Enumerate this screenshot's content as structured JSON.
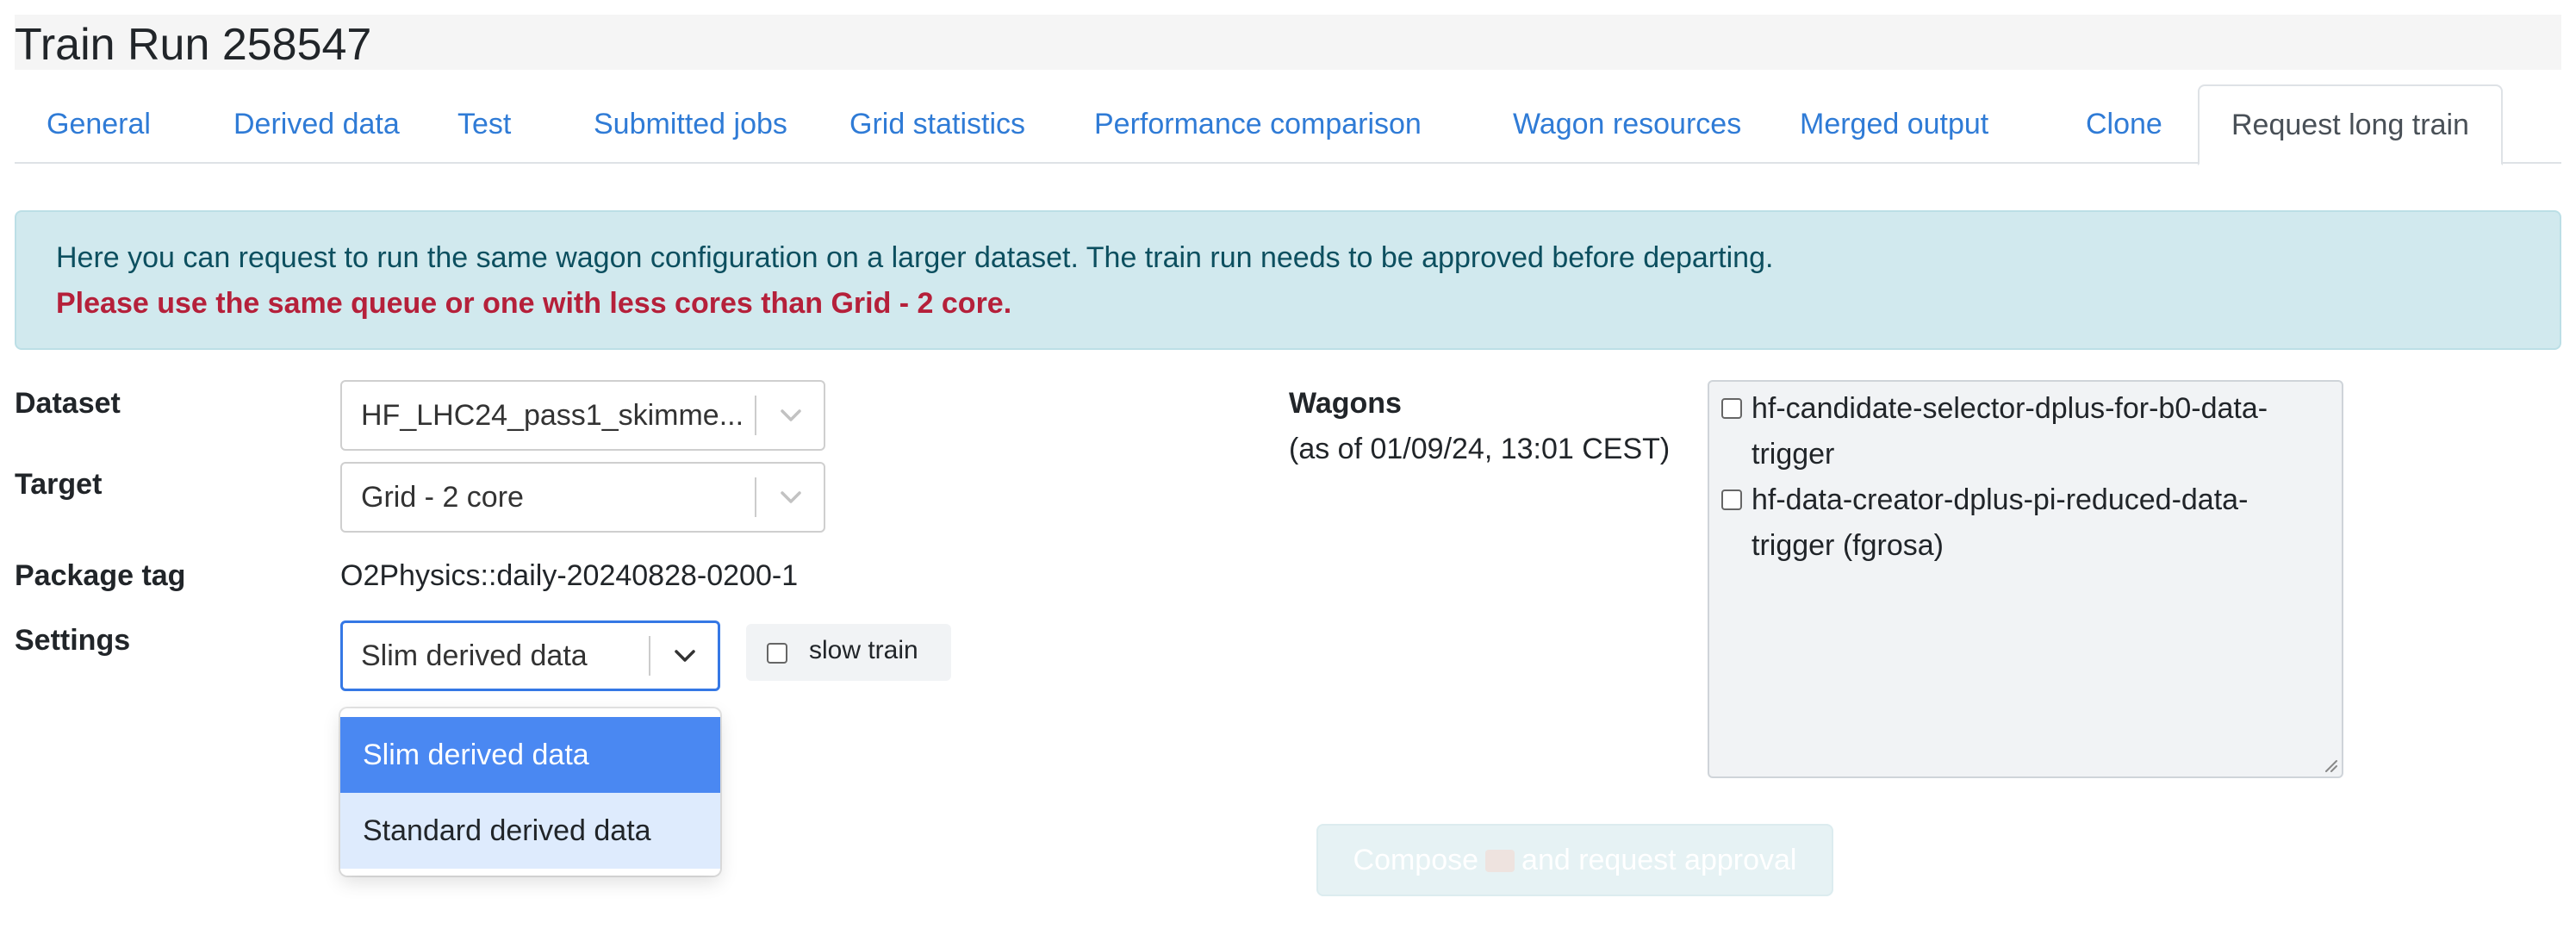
{
  "page": {
    "title": "Train Run 258547"
  },
  "tabs": [
    {
      "label": "General"
    },
    {
      "label": "Derived data"
    },
    {
      "label": "Test"
    },
    {
      "label": "Submitted jobs"
    },
    {
      "label": "Grid statistics"
    },
    {
      "label": "Performance comparison"
    },
    {
      "label": "Wagon resources"
    },
    {
      "label": "Merged output"
    },
    {
      "label": "Clone"
    },
    {
      "label": "Request long train",
      "active": true
    }
  ],
  "alert": {
    "info": "Here you can request to run the same wagon configuration on a larger dataset. The train run needs to be approved before departing.",
    "warning": "Please use the same queue or one with less cores than Grid - 2 core."
  },
  "form": {
    "dataset_label": "Dataset",
    "dataset_value": "HF_LHC24_pass1_skimme...",
    "target_label": "Target",
    "target_value": "Grid - 2 core",
    "package_label": "Package tag",
    "package_value": "O2Physics::daily-20240828-0200-1",
    "settings_label": "Settings",
    "settings_value": "Slim derived data",
    "slow_train_label": "slow train",
    "slow_train_checked": false
  },
  "settings_dropdown": {
    "options": [
      "Slim derived data",
      "Standard derived data"
    ],
    "selected": "Slim derived data",
    "highlighted": "Standard derived data"
  },
  "wagons": {
    "label": "Wagons",
    "asof": "(as of 01/09/24, 13:01 CEST)",
    "items": [
      {
        "name": "hf-candidate-selector-dplus-for-b0-data-trigger",
        "owner": "",
        "checked": false
      },
      {
        "name": "hf-data-creator-dplus-pi-reduced-data-trigger",
        "owner": "fgrosa",
        "checked": false
      }
    ]
  },
  "compose": {
    "before": "Compose",
    "icon": "train-icon",
    "after": "and request approval",
    "disabled": true
  },
  "colors": {
    "link": "#2f7bd6",
    "alert_bg": "#d1e9ee",
    "alert_text": "#0c4f5f",
    "warning_text": "#b5203a",
    "option_selected": "#4a88f2",
    "option_hover": "#deebfd",
    "focus_border": "#3578e5"
  }
}
